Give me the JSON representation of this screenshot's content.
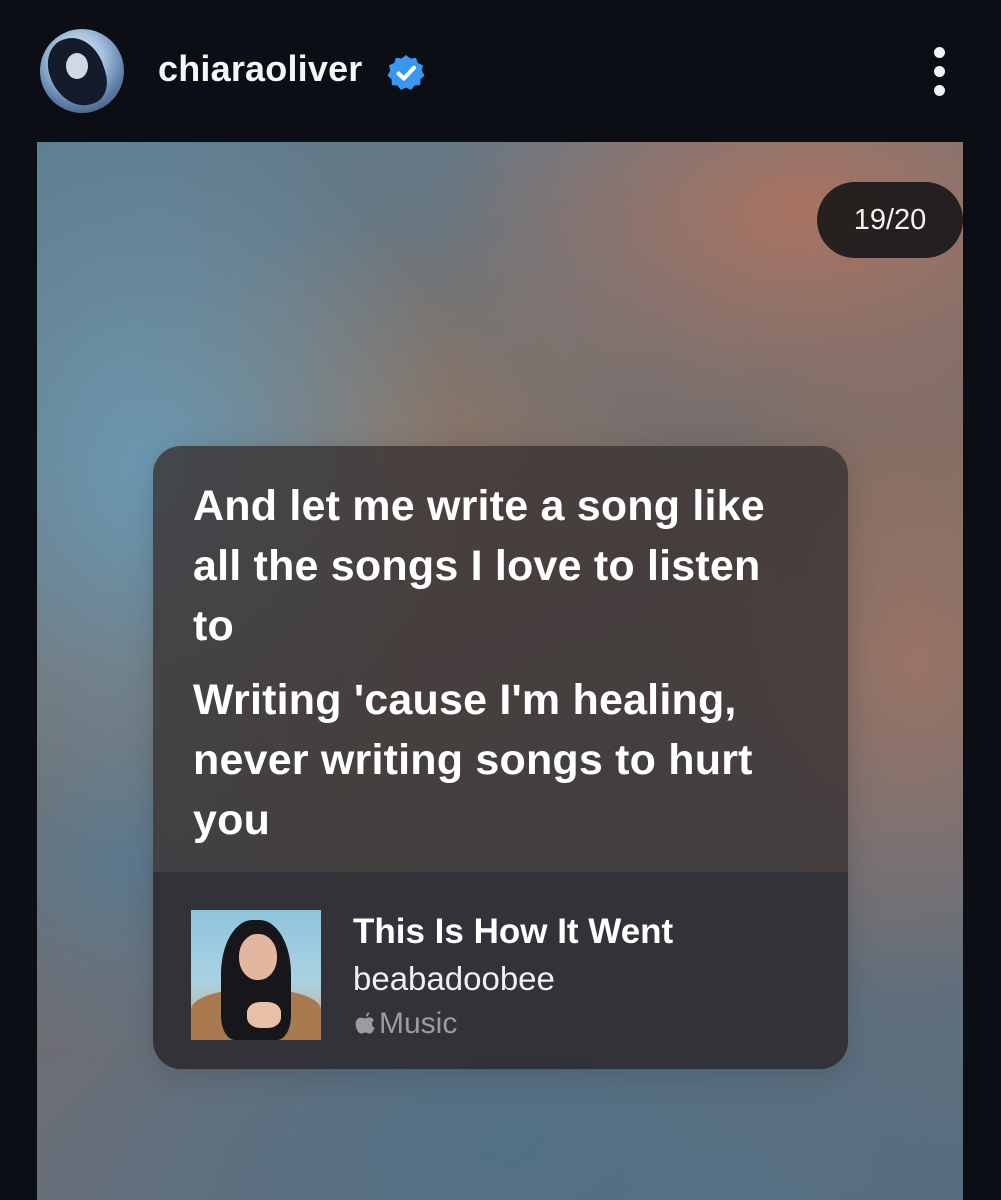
{
  "header": {
    "username": "chiaraoliver",
    "verified": true,
    "avatar_icon": "profile-photo",
    "more_icon": "vertical-ellipsis"
  },
  "story": {
    "counter": "19/20",
    "lyrics": [
      "And let me write a song like all the songs I love to listen to",
      "Writing 'cause I'm healing, never writing songs to hurt you"
    ],
    "song": {
      "title": "This Is How It Went",
      "artist": "beabadoobee",
      "service": "Music",
      "service_icon": "apple-logo"
    }
  },
  "colors": {
    "background": "#0b0e14",
    "verified_badge": "#3897f0",
    "text_primary": "#ffffff",
    "text_secondary": "#9a9ca2"
  }
}
